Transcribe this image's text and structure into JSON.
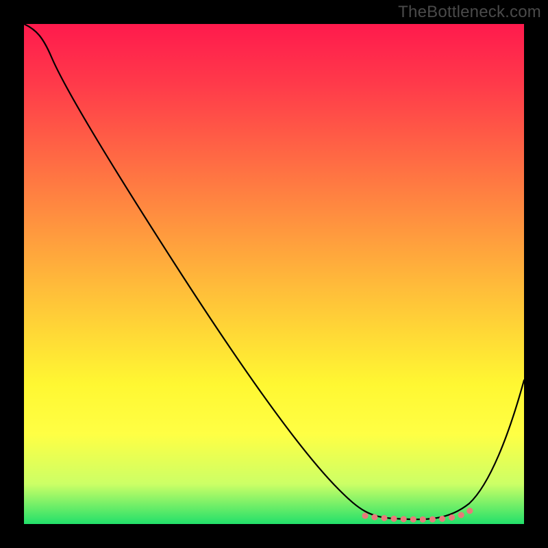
{
  "watermark": "TheBottleneck.com",
  "chart_data": {
    "type": "line",
    "title": "",
    "xlabel": "",
    "ylabel": "",
    "xlim": [
      0,
      100
    ],
    "ylim": [
      0,
      100
    ],
    "series": [
      {
        "name": "curve",
        "x": [
          0,
          4,
          10,
          20,
          30,
          40,
          50,
          60,
          65,
          70,
          75,
          80,
          85,
          90,
          95,
          100
        ],
        "y": [
          100,
          97,
          90,
          77,
          64,
          51,
          38,
          25,
          17,
          8,
          2,
          1,
          1,
          4,
          15,
          30
        ]
      }
    ],
    "optimal_band": {
      "x_start": 68,
      "x_end": 90,
      "y": 1.5
    },
    "background_gradient": [
      "#ff1a4d",
      "#ffff44",
      "#22e06a"
    ]
  }
}
